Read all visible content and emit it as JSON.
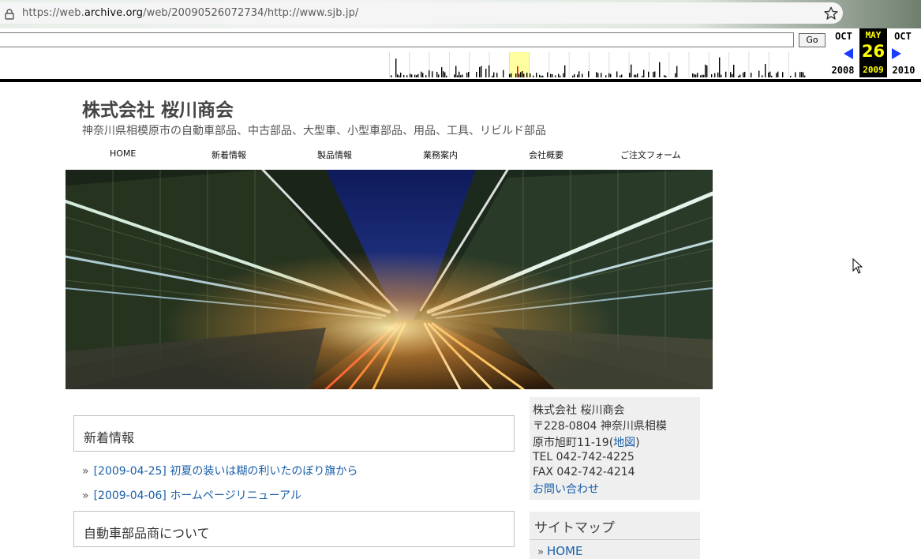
{
  "browser": {
    "url_prefix": "https://web.",
    "url_domain": "archive.org",
    "url_suffix": "/web/20090526072734/http://www.sjb.jp/",
    "icons": [
      "lock-icon",
      "star-icon"
    ]
  },
  "wayback": {
    "go_label": "Go",
    "prev_month": "OCT",
    "prev_year": "2008",
    "current_month": "MAY",
    "current_day": "26",
    "current_year": "2009",
    "next_month": "OCT",
    "next_year": "2010",
    "colors": {
      "current_bg": "#000000",
      "current_text": "#ffff00",
      "arrow": "#1a3cff",
      "highlight": "#ffffa0"
    }
  },
  "site": {
    "title": "株式会社 桜川商会",
    "subtitle": "神奈川県相模原市の自動車部品、中古部品、大型車、小型車部品、用品、工具、リビルド部品",
    "nav": [
      "HOME",
      "新着情報",
      "製品情報",
      "業務案内",
      "会社概要",
      "ご注文フォーム"
    ]
  },
  "main": {
    "news_heading": "新着情報",
    "news": [
      "[2009-04-25] 初夏の装いは糊の利いたのぼり旗から",
      "[2009-04-06] ホームページリニューアル"
    ],
    "about_heading": "自動車部品商について",
    "bullet": "»"
  },
  "sidebar": {
    "company": "株式会社 桜川商会",
    "address1": "〒228-0804 神奈川県相模",
    "address2": "原市旭町11-19",
    "map_paren_open": "(",
    "map_link": "地図",
    "map_paren_close": ")",
    "tel": "TEL 042-742-4225",
    "fax": "FAX 042-742-4214",
    "contact": "お問い合わせ",
    "sitemap_heading": "サイトマップ",
    "sitemap_items": [
      "HOME"
    ]
  }
}
